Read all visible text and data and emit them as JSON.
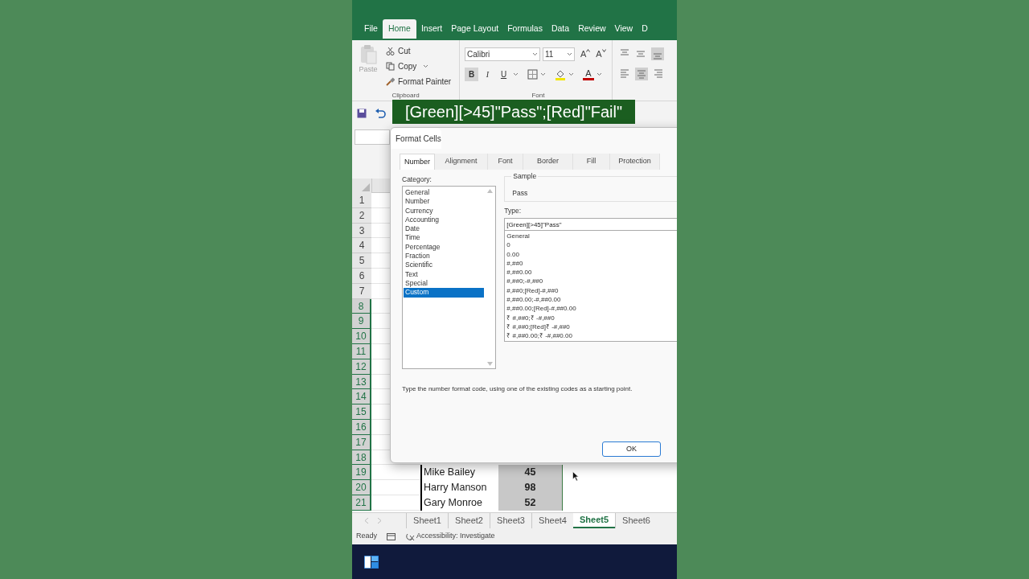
{
  "ribbon": {
    "tabs": [
      {
        "label": "File",
        "selected": false
      },
      {
        "label": "Home",
        "selected": true
      },
      {
        "label": "Insert",
        "selected": false
      },
      {
        "label": "Page Layout",
        "selected": false
      },
      {
        "label": "Formulas",
        "selected": false
      },
      {
        "label": "Data",
        "selected": false
      },
      {
        "label": "Review",
        "selected": false
      },
      {
        "label": "View",
        "selected": false
      },
      {
        "label": "D",
        "selected": false
      }
    ],
    "clipboard": {
      "paste": "Paste",
      "cut": "Cut",
      "copy": "Copy",
      "format_painter": "Format Painter",
      "group_label": "Clipboard"
    },
    "font": {
      "name": "Calibri",
      "size": "11",
      "grow_font": "A",
      "shrink_font": "A",
      "font_color": "A",
      "bold": "B",
      "italic": "I",
      "underline": "U",
      "group_label": "Font"
    }
  },
  "caption": "[Green][>45]\"Pass\";[Red]\"Fail\"",
  "sheet": {
    "rows": [
      {
        "number": "1",
        "selected": false
      },
      {
        "number": "2",
        "selected": false
      },
      {
        "number": "3",
        "selected": false
      },
      {
        "number": "4",
        "selected": false
      },
      {
        "number": "5",
        "selected": false
      },
      {
        "number": "6",
        "selected": false
      },
      {
        "number": "7",
        "selected": false
      },
      {
        "number": "8",
        "selected": true
      },
      {
        "number": "9",
        "selected": true
      },
      {
        "number": "10",
        "selected": true
      },
      {
        "number": "11",
        "selected": true
      },
      {
        "number": "12",
        "selected": true
      },
      {
        "number": "13",
        "selected": true
      },
      {
        "number": "14",
        "selected": true
      },
      {
        "number": "15",
        "selected": true
      },
      {
        "number": "16",
        "selected": true
      },
      {
        "number": "17",
        "selected": true
      },
      {
        "number": "18",
        "selected": true
      },
      {
        "number": "19",
        "selected": true,
        "name": "Mike Bailey",
        "score": "45"
      },
      {
        "number": "20",
        "selected": true,
        "name": "Harry Manson",
        "score": "98"
      },
      {
        "number": "21",
        "selected": true,
        "name": "Gary Monroe",
        "score": "52"
      }
    ]
  },
  "dialog": {
    "title": "Format Cells",
    "tabs": [
      {
        "label": "Number",
        "selected": true
      },
      {
        "label": "Alignment",
        "selected": false
      },
      {
        "label": "Font",
        "selected": false
      },
      {
        "label": "Border",
        "selected": false
      },
      {
        "label": "Fill",
        "selected": false
      },
      {
        "label": "Protection",
        "selected": false
      }
    ],
    "category_label": "Category:",
    "categories": [
      {
        "label": "General",
        "selected": false
      },
      {
        "label": "Number",
        "selected": false
      },
      {
        "label": "Currency",
        "selected": false
      },
      {
        "label": "Accounting",
        "selected": false
      },
      {
        "label": "Date",
        "selected": false
      },
      {
        "label": "Time",
        "selected": false
      },
      {
        "label": "Percentage",
        "selected": false
      },
      {
        "label": "Fraction",
        "selected": false
      },
      {
        "label": "Scientific",
        "selected": false
      },
      {
        "label": "Text",
        "selected": false
      },
      {
        "label": "Special",
        "selected": false
      },
      {
        "label": "Custom",
        "selected": true
      }
    ],
    "sample_label": "Sample",
    "sample_value": "Pass",
    "type_label": "Type:",
    "type_value": "[Green][>45]\"Pass\"",
    "type_list": [
      "General",
      "0",
      "0.00",
      "#,##0",
      "#,##0.00",
      "#,##0;-#,##0",
      "#,##0;[Red]-#,##0",
      "#,##0.00;-#,##0.00",
      "#,##0.00;[Red]-#,##0.00",
      "₹ #,##0;₹ -#,##0",
      "₹ #,##0;[Red]₹ -#,##0",
      "₹ #,##0.00;₹ -#,##0.00"
    ],
    "hint": "Type the number format code, using one of the existing codes as a starting point.",
    "ok": "OK"
  },
  "sheet_tabs": [
    {
      "label": "Sheet1",
      "selected": false
    },
    {
      "label": "Sheet2",
      "selected": false
    },
    {
      "label": "Sheet3",
      "selected": false
    },
    {
      "label": "Sheet4",
      "selected": false
    },
    {
      "label": "Sheet5",
      "selected": true
    },
    {
      "label": "Sheet6",
      "selected": false
    }
  ],
  "status_bar": {
    "ready": "Ready",
    "accessibility": "Accessibility: Investigate"
  }
}
